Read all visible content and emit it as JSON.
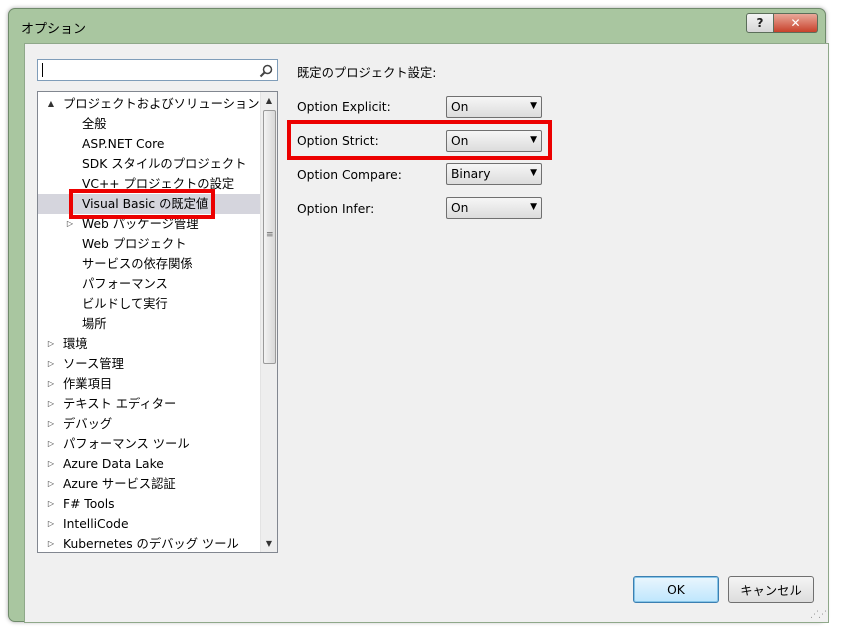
{
  "window": {
    "title": "オプション",
    "help_label": "?",
    "close_label": "✕"
  },
  "search": {
    "value": "",
    "icon": "search-icon"
  },
  "tree": {
    "items": [
      {
        "label": "プロジェクトおよびソリューション",
        "level": 0,
        "arrow": "▲",
        "selected": false
      },
      {
        "label": "全般",
        "level": 1,
        "arrow": "",
        "selected": false
      },
      {
        "label": "ASP.NET Core",
        "level": 1,
        "arrow": "",
        "selected": false
      },
      {
        "label": "SDK スタイルのプロジェクト",
        "level": 1,
        "arrow": "",
        "selected": false
      },
      {
        "label": "VC++ プロジェクトの設定",
        "level": 1,
        "arrow": "",
        "selected": false
      },
      {
        "label": "Visual Basic の既定値",
        "level": 1,
        "arrow": "",
        "selected": true
      },
      {
        "label": "Web パッケージ管理",
        "level": 1,
        "arrow": "▷",
        "selected": false
      },
      {
        "label": "Web プロジェクト",
        "level": 1,
        "arrow": "",
        "selected": false
      },
      {
        "label": "サービスの依存関係",
        "level": 1,
        "arrow": "",
        "selected": false
      },
      {
        "label": "パフォーマンス",
        "level": 1,
        "arrow": "",
        "selected": false
      },
      {
        "label": "ビルドして実行",
        "level": 1,
        "arrow": "",
        "selected": false
      },
      {
        "label": "場所",
        "level": 1,
        "arrow": "",
        "selected": false
      },
      {
        "label": "環境",
        "level": 0,
        "arrow": "▷",
        "selected": false
      },
      {
        "label": "ソース管理",
        "level": 0,
        "arrow": "▷",
        "selected": false
      },
      {
        "label": "作業項目",
        "level": 0,
        "arrow": "▷",
        "selected": false
      },
      {
        "label": "テキスト エディター",
        "level": 0,
        "arrow": "▷",
        "selected": false
      },
      {
        "label": "デバッグ",
        "level": 0,
        "arrow": "▷",
        "selected": false
      },
      {
        "label": "パフォーマンス ツール",
        "level": 0,
        "arrow": "▷",
        "selected": false
      },
      {
        "label": "Azure Data Lake",
        "level": 0,
        "arrow": "▷",
        "selected": false
      },
      {
        "label": "Azure サービス認証",
        "level": 0,
        "arrow": "▷",
        "selected": false
      },
      {
        "label": "F# Tools",
        "level": 0,
        "arrow": "▷",
        "selected": false
      },
      {
        "label": "IntelliCode",
        "level": 0,
        "arrow": "▷",
        "selected": false
      },
      {
        "label": "Kubernetes のデバッグ ツール",
        "level": 0,
        "arrow": "▷",
        "selected": false
      }
    ]
  },
  "settings": {
    "heading": "既定のプロジェクト設定:",
    "options": [
      {
        "label": "Option Explicit:",
        "value": "On"
      },
      {
        "label": "Option Strict:",
        "value": "On"
      },
      {
        "label": "Option Compare:",
        "value": "Binary"
      },
      {
        "label": "Option Infer:",
        "value": "On"
      }
    ]
  },
  "buttons": {
    "ok": "OK",
    "cancel": "キャンセル"
  },
  "colors": {
    "highlight": "#ec0000",
    "selection": "#d5d5dd"
  }
}
